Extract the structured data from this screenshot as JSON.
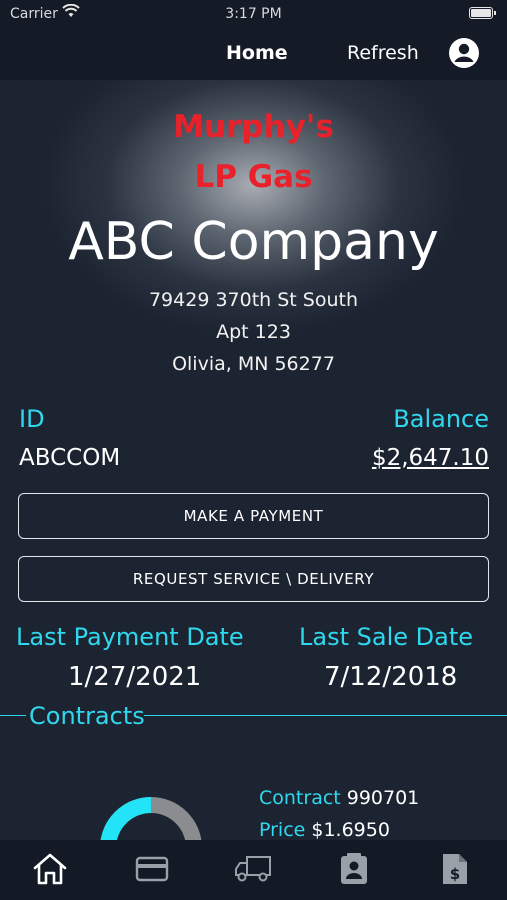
{
  "status_bar": {
    "carrier": "Carrier",
    "time": "3:17 PM"
  },
  "nav": {
    "home_label": "Home",
    "refresh_label": "Refresh",
    "account_icon": "person-circle-icon"
  },
  "brand": {
    "line1": "Murphy's",
    "line2": "LP Gas",
    "color": "#e8212b"
  },
  "customer": {
    "company": "ABC Company",
    "address_line1": "79429 370th St South",
    "address_line2": "Apt 123",
    "address_line3": "Olivia, MN 56277"
  },
  "account": {
    "id_label": "ID",
    "id_value": "ABCCOM",
    "balance_label": "Balance",
    "balance_value": "$2,647.10"
  },
  "actions": {
    "make_payment": "MAKE A PAYMENT",
    "request_service": "REQUEST SERVICE \\ DELIVERY"
  },
  "dates": {
    "last_payment_label": "Last Payment Date",
    "last_payment_value": "1/27/2021",
    "last_sale_label": "Last Sale Date",
    "last_sale_value": "7/12/2018"
  },
  "contracts": {
    "title": "Contracts",
    "items": [
      {
        "contract_label": "Contract",
        "contract_value": "990701",
        "price_label": "Price",
        "price_value": "$1.6950",
        "gauge_fill_fraction": 0.5
      }
    ]
  },
  "tab_bar": {
    "tabs": [
      {
        "icon": "home-icon",
        "active": true
      },
      {
        "icon": "credit-card-icon",
        "active": false
      },
      {
        "icon": "delivery-truck-icon",
        "active": false
      },
      {
        "icon": "contact-card-icon",
        "active": false
      },
      {
        "icon": "invoice-dollar-icon",
        "active": false
      }
    ]
  },
  "colors": {
    "accent": "#2fd8ee",
    "background": "#1b2230",
    "bar": "#141a26"
  }
}
